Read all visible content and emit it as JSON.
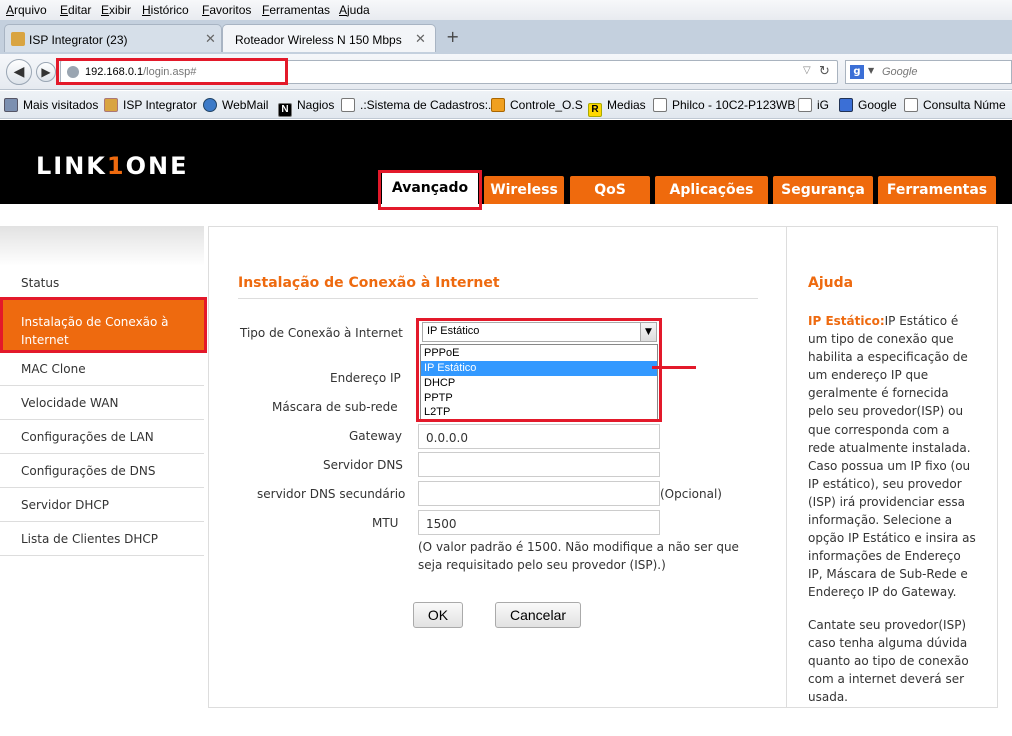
{
  "browser": {
    "menu": [
      "Arquivo",
      "Editar",
      "Exibir",
      "Histórico",
      "Favoritos",
      "Ferramentas",
      "Ajuda"
    ],
    "tabs": [
      {
        "label": "ISP Integrator (23)"
      },
      {
        "label": "Roteador Wireless N 150 Mbps"
      }
    ],
    "url_host": "192.168.0.1",
    "url_path": "/login.asp#",
    "search_placeholder": "Google",
    "bookmarks": [
      "Mais visitados",
      "ISP Integrator",
      "WebMail",
      "Nagios",
      ".:Sistema de Cadastros:.",
      "Controle_O.S",
      "Medias",
      "Philco - 10C2-P123WB",
      "iG",
      "Google",
      "Consulta Núme"
    ]
  },
  "router": {
    "logo_left": "LINK",
    "logo_mid": "1",
    "logo_right": "ONE",
    "nav_tabs": [
      "Avançado",
      "Wireless",
      "QoS",
      "Aplicações",
      "Segurança",
      "Ferramentas"
    ],
    "sidebar": [
      "Status",
      "Instalação de Conexão à Internet",
      "MAC Clone",
      "Velocidade WAN",
      "Configurações de LAN",
      "Configurações de DNS",
      "Servidor DHCP",
      "Lista de Clientes DHCP"
    ],
    "page_title": "Instalação de Conexão à Internet",
    "form": {
      "connection_type_label": "Tipo de Conexão à Internet",
      "connection_type_value": "IP Estático",
      "connection_options": [
        "PPPoE",
        "IP Estático",
        "DHCP",
        "PPTP",
        "L2TP"
      ],
      "selected_option": "IP Estático",
      "ip_label": "Endereço IP",
      "mask_label": "Máscara de sub-rede",
      "gateway_label": "Gateway",
      "gateway_value": "0.0.0.0",
      "dns_label": "Servidor DNS",
      "dns_value": "",
      "dns2_label": "servidor DNS secundário",
      "dns2_value": "",
      "optional": "(Opcional)",
      "mtu_label": "MTU",
      "mtu_value": "1500",
      "mtu_note": "(O valor padrão é 1500. Não modifique a não ser que seja requisitado pelo seu provedor (ISP).)",
      "ok": "OK",
      "cancel": "Cancelar"
    },
    "help": {
      "title": "Ajuda",
      "key": "IP Estático:",
      "para1": "IP Estático é um tipo de conexão que habilita a especificação de um endereço IP que geralmente é fornecida pelo seu provedor(ISP) ou que corresponda com a rede atualmente instalada. Caso possua um IP fixo (ou IP estático), seu provedor (ISP) irá providenciar essa informação. Selecione a opção IP Estático e insira as informações de Endereço IP, Máscara de Sub-Rede e Endereço IP do Gateway.",
      "para2": "Cantate seu provedor(ISP) caso tenha alguma dúvida quanto ao tipo de conexão com a internet deverá ser usada."
    }
  },
  "colors": {
    "accent": "#ee6a0f",
    "highlight": "#e3192a",
    "selection": "#3399ff"
  }
}
